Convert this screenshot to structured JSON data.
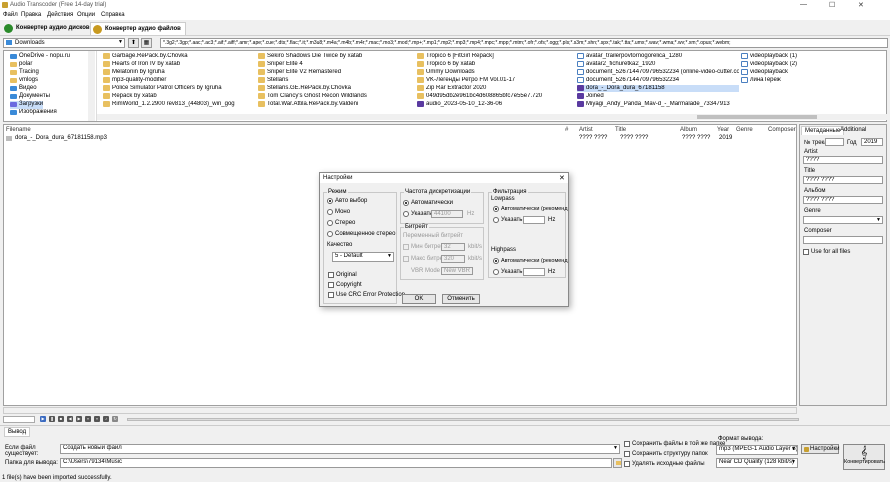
{
  "window": {
    "title": "Audio Transcoder (Free 14-day trial)",
    "min": "—",
    "max": "☐",
    "close": "✕"
  },
  "menu": [
    "Файл",
    "Правка",
    "Действия",
    "Опции",
    "Справка"
  ],
  "tabs": [
    {
      "label": "Конвертер аудио дисков",
      "icon_color": "#2a8a2a"
    },
    {
      "label": "Конвертер аудио файлов",
      "icon_color": "#c89a20"
    }
  ],
  "path": {
    "folder": "Downloads",
    "filter": "*.3g2;*.3gp;*.aac;*.ac3;*.aif;*.aiff;*.amr;*.ape;*.cue;*.dts;*.flac;*.it;*.m3u8;*.m4a;*.m4b;*.m4r;*.mac;*.mo3;*.mod;*.mp+;*.mp1;*.mp2;*.mp3;*.mp4;*.mpc;*.mpp;*.mtm;*.ofr;*.ofs;*.ogg;*.pls;*.s3m;*.shn;*.spx;*.tak;*.tta;*.umx;*.wav;*.wma;*.wv;*.xm;*.opus;*.webm;"
  },
  "tree": [
    {
      "label": "OneDrive - nopu.ru",
      "icon": "cloud-icon"
    },
    {
      "label": "polar",
      "icon": "folder-icon"
    },
    {
      "label": "Tracing",
      "icon": "folder-icon"
    },
    {
      "label": "vmlogs",
      "icon": "folder-icon"
    },
    {
      "label": "Видео",
      "icon": "folder-icon"
    },
    {
      "label": "Документы",
      "icon": "folder-icon"
    },
    {
      "label": "Загрузки",
      "icon": "folder-icon"
    },
    {
      "label": "Изображения",
      "icon": "folder-icon"
    }
  ],
  "files": {
    "col1": [
      "Garbage.RePack.by.Chovka",
      "Hearts of Iron IV by xatab",
      "Melatonin by Igruha",
      "mp3-quality-modifier",
      "Police Simulator Patrol Officers by Igruha",
      "Repack by xatab",
      "RimWorld_1.2.2900 rev813_(44803)_win_gog"
    ],
    "col2": [
      "Sekiro Shadows Die Twice by xatab",
      "Sniper Elite 4",
      "Sniper Elite V2 Remastered",
      "Stellaris",
      "Stellaris.GE.RePack.by.Chovka",
      "Tom Clancy's Ghost Recon Wildlands",
      "Total.War.Attila.RePack.by.Valdeni"
    ],
    "col3": [
      "Tropico 6 [FitGirl Repack]",
      "Tropico 6 by xatab",
      "Ummy Downloads",
      "VK-Легенды Ретро FM Vol.01-17",
      "Zip Rar Extractor 2020",
      "049d95db2e961bc4d608865bfc7e55e7.720",
      "audio_2023-05-10_12-36-06"
    ],
    "col4": [
      "avatar_trailerpovtornogorelica_1280",
      "avatar2_fichuretka2_1920",
      "document_5267144709796532234 (online-video-cutter.com)",
      "document_5267144709796532234",
      "dora_-_Dora_dura_67181158",
      "Joined",
      "Miyagi_Andy_Panda_Mav-d_-_Marmalade_73347913"
    ],
    "col5": [
      "videoplayback (1)",
      "videoplayback (2)",
      "videoplayback",
      "линаТереж"
    ]
  },
  "columns": {
    "filename": "Filename",
    "num": "#",
    "artist": "Artist",
    "title": "Title",
    "album": "Album",
    "year": "Year",
    "genre": "Genre",
    "composer": "Composer"
  },
  "rows": [
    {
      "filename": "dora_-_Dora_dura_67181158.mp3",
      "artist": "???? ????",
      "title": "???? ????",
      "album": "???? ????",
      "year": "2019"
    }
  ],
  "meta": {
    "tab_meta": "Метаданные",
    "tab_add": "Additional",
    "track_label": "№ трека",
    "year_label": "Год",
    "year": "2019",
    "artist_label": "Artist",
    "artist": "????",
    "title_label": "Title",
    "title": "???? ????",
    "album_label": "Альбом",
    "album": "???? ????",
    "genre_label": "Genre",
    "composer_label": "Composer",
    "use_all": "Use for all files"
  },
  "dialog": {
    "title": "Настройки",
    "close": "✕",
    "mode_label": "Режим",
    "modes": [
      "Авто выбор",
      "Моно",
      "Стерео",
      "Совмещенное стерео"
    ],
    "quality_label": "Качество",
    "quality": "5 - Default",
    "chk_original": "Original",
    "chk_copyright": "Copyright",
    "chk_crc": "Use CRC Error Protection",
    "rate_label": "Частота дискретизации",
    "rate_auto": "Автоматически",
    "rate_spec": "Указать",
    "rate_value": "44100",
    "rate_unit": "Hz",
    "bitrate_label": "Битрейт",
    "bitrate_var": "Переменный битрейт",
    "min_br": "Мин битрей",
    "min_val": "32",
    "max_br": "Макс битрей",
    "max_val": "320",
    "kbits": "kbit/s",
    "vbr_label": "VBR Mode",
    "vbr_val": "New VBR",
    "filter_label": "Фильтрация",
    "lowpass": "Lowpass",
    "hp": "Highpass",
    "auto_rec": "Автоматически (рекоменд",
    "spec": "Указать",
    "hz": "Hz",
    "ok": "OK",
    "cancel": "Отменить"
  },
  "output": {
    "tab": "Вывод",
    "exists_label1": "Если файл",
    "exists_label2": "существует:",
    "exists_value": "Создать новый файл",
    "folder_label": "Папка для вывода:",
    "folder_value": "C:\\Users\\79134\\Music",
    "opt1": "Сохранить файлы в той же папке",
    "opt2": "Сохранить структуру папок",
    "opt3": "Удалять исходные файлы",
    "format_label": "Формат вывода:",
    "format": "mp3 (MPEG-1 Audio Layer 3)",
    "settings": "Настройки",
    "quality": "Near CD Quality (128 kbit/s)",
    "convert": "Конвертировать"
  },
  "status": "1 file(s) have been imported successfully."
}
